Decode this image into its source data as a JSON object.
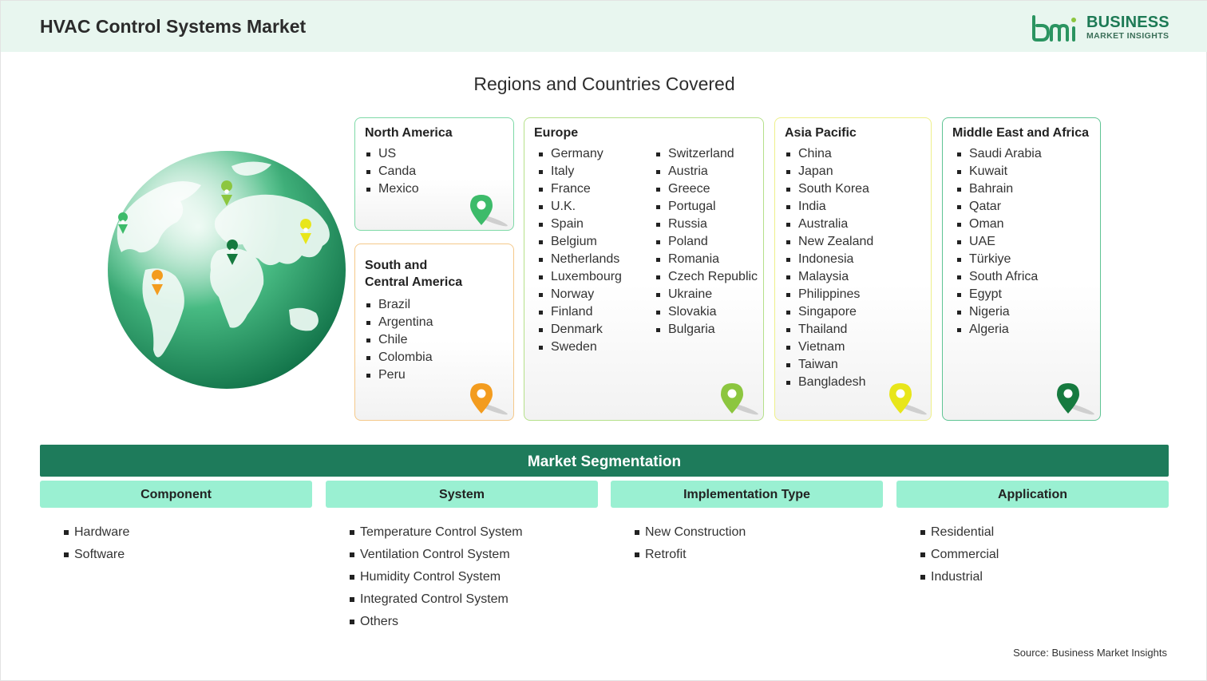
{
  "header": {
    "title": "HVAC Control Systems Market",
    "logo": {
      "word1": "BUSINESS",
      "word2": "MARKET INSIGHTS",
      "mark": "bmi"
    }
  },
  "regions": {
    "title": "Regions and Countries Covered",
    "north_america": {
      "title": "North America",
      "color": "#7ed9a7",
      "pin_color": "#3dbb6a",
      "items": [
        "US",
        "Canda",
        "Mexico"
      ]
    },
    "south_central_america": {
      "title_line1": "South and",
      "title_line2": "Central America",
      "color": "#f5c98a",
      "pin_color": "#f39c1f",
      "items": [
        "Brazil",
        "Argentina",
        "Chile",
        "Colombia",
        "Peru"
      ]
    },
    "europe": {
      "title": "Europe",
      "color": "#b5e08a",
      "pin_color": "#8cc63f",
      "items_col1": [
        "Germany",
        "Italy",
        "France",
        "U.K.",
        "Spain",
        "Belgium",
        "Netherlands",
        "Luxembourg",
        "Norway",
        "Finland",
        "Denmark",
        "Sweden"
      ],
      "items_col2": [
        "Switzerland",
        "Austria",
        "Greece",
        "Portugal",
        "Russia",
        "Poland",
        "Romania",
        "Czech Republic",
        "Ukraine",
        "Slovakia",
        "Bulgaria"
      ]
    },
    "asia_pacific": {
      "title": "Asia Pacific",
      "color": "#eef08a",
      "pin_color": "#e8e61a",
      "items": [
        "China",
        "Japan",
        "South Korea",
        "India",
        "Australia",
        "New Zealand",
        "Indonesia",
        "Malaysia",
        "Philippines",
        "Singapore",
        "Thailand",
        "Vietnam",
        "Taiwan",
        "Bangladesh"
      ]
    },
    "middle_east_africa": {
      "title": "Middle East and Africa",
      "color": "#5fc494",
      "pin_color": "#167a3f",
      "items": [
        "Saudi Arabia",
        "Kuwait",
        "Bahrain",
        "Qatar",
        "Oman",
        "UAE",
        "Türkiye",
        "South Africa",
        "Egypt",
        "Nigeria",
        "Algeria"
      ]
    }
  },
  "segmentation": {
    "title": "Market Segmentation",
    "columns": [
      {
        "header": "Component",
        "items": [
          "Hardware",
          "Software"
        ]
      },
      {
        "header": "System",
        "items": [
          "Temperature Control System",
          "Ventilation Control System",
          "Humidity Control System",
          "Integrated Control System",
          "Others"
        ]
      },
      {
        "header": "Implementation Type",
        "items": [
          "New Construction",
          "Retrofit"
        ]
      },
      {
        "header": "Application",
        "items": [
          "Residential",
          "Commercial",
          "Industrial"
        ]
      }
    ]
  },
  "source": "Source: Business Market Insights",
  "colors": {
    "brand_green": "#1e7b5b",
    "header_bg": "#e8f6ef",
    "seg_header_bg": "#9af0d2"
  }
}
